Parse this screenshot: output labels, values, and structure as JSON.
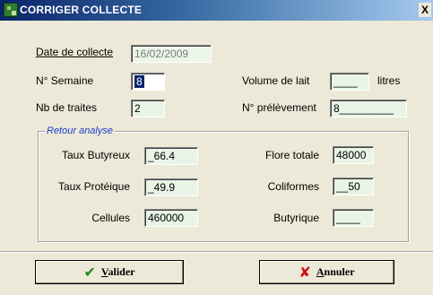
{
  "window": {
    "title": "CORRIGER COLLECTE",
    "close_label": "X"
  },
  "form": {
    "date_label": "Date de collecte",
    "date_value": "16/02/2009",
    "semaine_label": "N° Semaine",
    "semaine_value": "8",
    "volume_label": "Volume de lait",
    "volume_value": "____",
    "volume_unit": "litres",
    "traites_label": "Nb de traites",
    "traites_value": "2",
    "prelevement_label": "N° prélèvement",
    "prelevement_value": "8_________"
  },
  "analyse": {
    "group_title": "Retour analyse",
    "tb_label": "Taux Butyreux",
    "tb_value": "_66.4",
    "flore_label": "Flore totale",
    "flore_value": "48000",
    "tp_label": "Taux Protéique",
    "tp_value": "_49.9",
    "coliformes_label": "Coliformes",
    "coliformes_value": "__50",
    "cellules_label": "Cellules",
    "cellules_value": "460000",
    "butyrique_label": "Butyrique",
    "butyrique_value": "____"
  },
  "buttons": {
    "valider_accel": "V",
    "valider_rest": "alider",
    "valider_icon": "✔",
    "annuler_accel": "A",
    "annuler_rest": "nnuler",
    "annuler_icon": "✘",
    "valider_icon_color": "#1f8a1f",
    "annuler_icon_color": "#d01010"
  }
}
